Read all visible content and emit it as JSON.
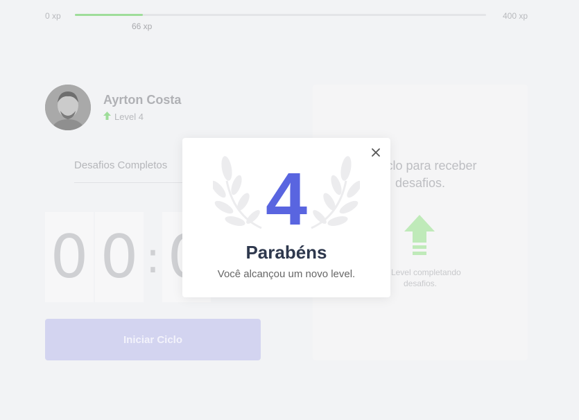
{
  "xp": {
    "min_label": "0 xp",
    "max_label": "400 xp",
    "current_label": "66 xp",
    "current": 66,
    "max": 400,
    "fill_color": "#9fdd9a"
  },
  "profile": {
    "name": "Ayrton Costa",
    "level_label": "Level 4",
    "level_icon": "level-up-arrow-icon"
  },
  "challenges": {
    "completed_label": "Desafios Completos"
  },
  "countdown": {
    "minutes": [
      "0",
      "0"
    ],
    "separator": ":",
    "seconds_visible": "0"
  },
  "actions": {
    "start_cycle_label": "Iniciar Ciclo"
  },
  "challenge_card": {
    "text_line1": "m ciclo para receber",
    "text_line2": "desafios.",
    "hint_line1": "de Level completando",
    "hint_line2": "desafios.",
    "icon": "level-up-icon"
  },
  "modal": {
    "level": "4",
    "title": "Parabéns",
    "subtitle": "Você alcançou um novo level.",
    "close_icon": "close-icon",
    "accent_color": "#5965e0"
  }
}
